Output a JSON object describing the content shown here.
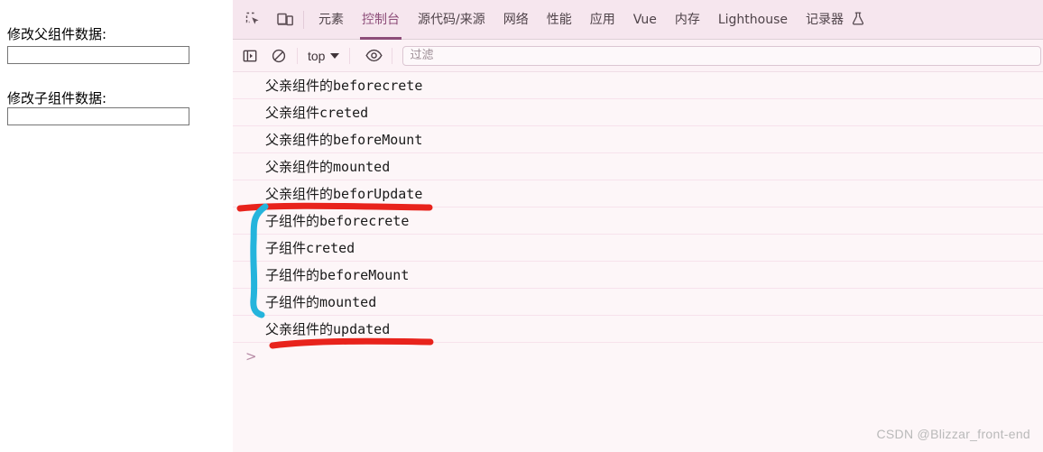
{
  "page": {
    "parent_label": "修改父组件数据:",
    "parent_input_value": "",
    "parent_input_placeholder": "",
    "child_label": "修改子组件数据:",
    "child_input_value": "",
    "child_input_placeholder": ""
  },
  "devtools": {
    "icons": {
      "inspect": "inspect-element-icon",
      "device": "device-toolbar-icon"
    },
    "tabs": [
      {
        "label": "元素",
        "active": false
      },
      {
        "label": "控制台",
        "active": true
      },
      {
        "label": "源代码/来源",
        "active": false
      },
      {
        "label": "网络",
        "active": false
      },
      {
        "label": "性能",
        "active": false
      },
      {
        "label": "应用",
        "active": false
      },
      {
        "label": "Vue",
        "active": false
      },
      {
        "label": "内存",
        "active": false
      },
      {
        "label": "Lighthouse",
        "active": false
      },
      {
        "label": "记录器",
        "active": false,
        "icon": "flask-icon"
      }
    ],
    "toolbar": {
      "sidebar_toggle": "show-console-sidebar-icon",
      "clear_console": "clear-console-icon",
      "context_value": "top",
      "eye_icon": "live-expression-eye-icon",
      "filter_placeholder": "过滤",
      "filter_value": ""
    },
    "console_messages": [
      {
        "cjk": "父亲组件的",
        "mono": "beforecrete"
      },
      {
        "cjk": "父亲组件",
        "mono": "creted"
      },
      {
        "cjk": "父亲组件的",
        "mono": "beforeMount"
      },
      {
        "cjk": "父亲组件的",
        "mono": "mounted"
      },
      {
        "cjk": "父亲组件的",
        "mono": "beforUpdate"
      },
      {
        "cjk": "子组件的",
        "mono": "beforecrete"
      },
      {
        "cjk": "子组件",
        "mono": "creted"
      },
      {
        "cjk": "子组件的",
        "mono": "beforeMount"
      },
      {
        "cjk": "子组件的",
        "mono": "mounted"
      },
      {
        "cjk": "父亲组件的",
        "mono": "updated"
      }
    ],
    "prompt_symbol": ">"
  },
  "annotations": {
    "red_color": "#e8231c",
    "cyan_color": "#25b4dc"
  },
  "watermark": "CSDN @Blizzar_front-end"
}
